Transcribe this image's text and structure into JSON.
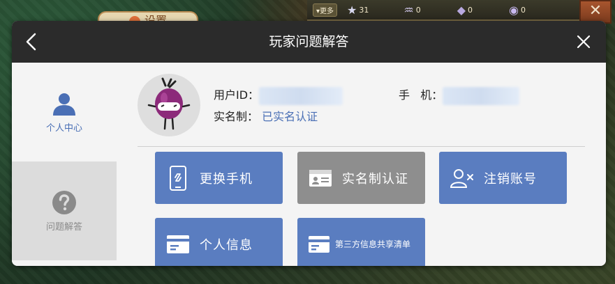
{
  "game": {
    "tab_label": "设置",
    "more_label": "更多",
    "resources": [
      {
        "icon": "star-icon",
        "value": "31"
      },
      {
        "icon": "shell-icon",
        "value": "0"
      },
      {
        "icon": "gem-icon",
        "value": "0"
      },
      {
        "icon": "swirl-gem-icon",
        "value": "0"
      }
    ]
  },
  "dialog": {
    "title": "玩家问题解答"
  },
  "sidebar": {
    "items": [
      {
        "label": "个人中心",
        "icon": "user-icon",
        "active": true
      },
      {
        "label": "问题解答",
        "icon": "help-icon",
        "active": false
      }
    ]
  },
  "profile": {
    "user_id_label": "用户ID：",
    "user_id_value": "",
    "phone_label": "手   机：",
    "phone_value": "",
    "realname_label": "实名制：",
    "realname_value": "已实名认证"
  },
  "actions": [
    {
      "label": "更换手机",
      "icon": "phone-link-icon",
      "style": "blue"
    },
    {
      "label": "实名制认证",
      "icon": "id-card-icon",
      "style": "gray"
    },
    {
      "label": "注销账号",
      "icon": "remove-user-icon",
      "style": "blue"
    },
    {
      "label": "个人信息",
      "icon": "info-card-icon",
      "style": "blue"
    },
    {
      "label": "第三方信息共享清单",
      "icon": "list-card-icon",
      "style": "blue"
    }
  ],
  "colors": {
    "header": "#2b2b2b",
    "accent_blue": "#5a7dc0",
    "disabled_gray": "#8e8e8e",
    "link_blue": "#4a6fb5"
  }
}
